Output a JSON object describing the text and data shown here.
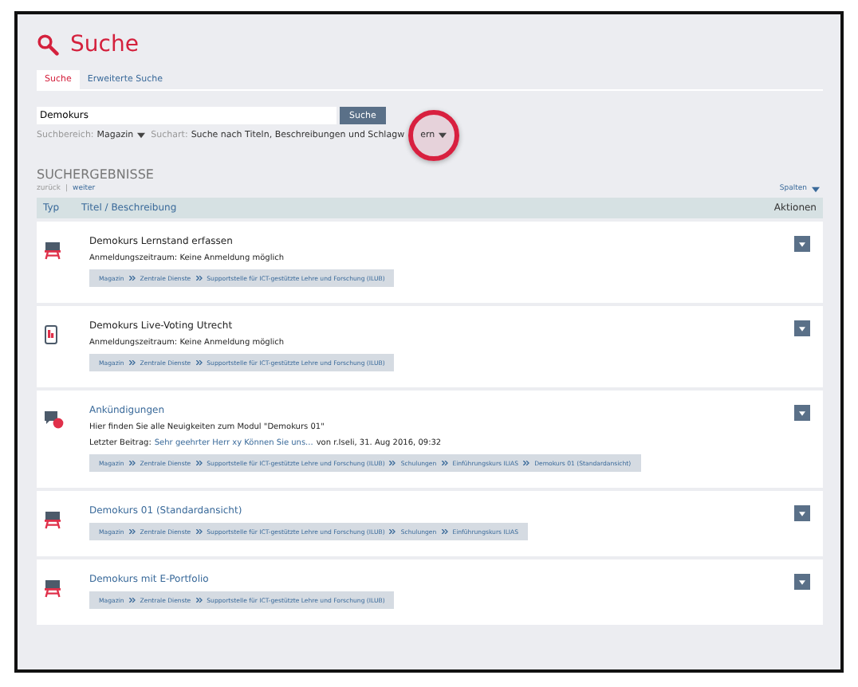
{
  "header": {
    "title": "Suche"
  },
  "tabs": [
    {
      "label": "Suche",
      "selected": true
    },
    {
      "label": "Erweiterte Suche",
      "selected": false
    }
  ],
  "search": {
    "value": "Demokurs",
    "button": "Suche"
  },
  "filters": [
    {
      "label": "Suchbereich:",
      "value": "Magazin"
    },
    {
      "label": "Suchart:",
      "value": "Suche nach Titeln, Beschreibungen und Schlagw",
      "value_tail": "ern"
    }
  ],
  "click_marker": true,
  "results": {
    "heading": "SUCHERGEBNISSE",
    "prev": "zurück",
    "separator": "|",
    "next": "weiter",
    "columns_button": "Spalten",
    "columns": [
      "Typ",
      "Titel / Beschreibung",
      "Aktionen"
    ],
    "rows": [
      {
        "kind": "course",
        "title": "Demokurs Lernstand erfassen",
        "linked": false,
        "lines": [
          {
            "kind": "text",
            "text": "Anmeldungszeitraum: Keine Anmeldung möglich"
          }
        ],
        "path": [
          "Magazin",
          "Zentrale Dienste",
          "Supportstelle für ICT-gestützte Lehre und Forschung (ILUB)"
        ]
      },
      {
        "kind": "poll",
        "title": "Demokurs Live-Voting Utrecht",
        "linked": false,
        "lines": [
          {
            "kind": "text",
            "text": "Anmeldungszeitraum: Keine Anmeldung möglich"
          }
        ],
        "path": [
          "Magazin",
          "Zentrale Dienste",
          "Supportstelle für ICT-gestützte Lehre und Forschung (ILUB)"
        ]
      },
      {
        "kind": "forum",
        "title": "Ankündigungen",
        "linked": true,
        "lines": [
          {
            "kind": "text",
            "text": "Hier finden Sie alle Neuigkeiten zum Modul \"Demokurs 01\""
          },
          {
            "kind": "post",
            "label": "Letzter Beitrag:",
            "link": "Sehr geehrter Herr xy Können Sie uns...",
            "meta": "von r.Iseli, 31. Aug 2016, 09:32"
          }
        ],
        "path": [
          "Magazin",
          "Zentrale Dienste",
          "Supportstelle für ICT-gestützte Lehre und Forschung (ILUB)",
          "Schulungen",
          "Einführungskurs ILIAS",
          "Demokurs 01 (Standardansicht)"
        ]
      },
      {
        "kind": "course",
        "title": "Demokurs 01 (Standardansicht)",
        "linked": true,
        "lines": [],
        "path": [
          "Magazin",
          "Zentrale Dienste",
          "Supportstelle für ICT-gestützte Lehre und Forschung (ILUB)",
          "Schulungen",
          "Einführungskurs ILIAS"
        ]
      },
      {
        "kind": "course",
        "title": "Demokurs mit E-Portfolio",
        "linked": true,
        "lines": [],
        "path": [
          "Magazin",
          "Zentrale Dienste",
          "Supportstelle für ICT-gestützte Lehre und Forschung (ILUB)"
        ]
      }
    ]
  }
}
